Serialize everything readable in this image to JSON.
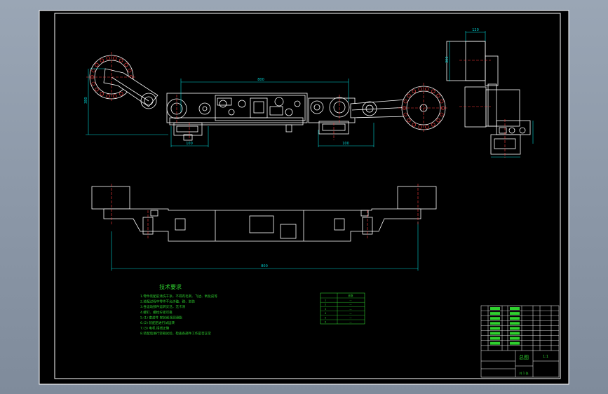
{
  "drawing": {
    "background": "#000000",
    "line_color": "#ffffff",
    "dim_color": "#00d6d6",
    "center_color": "#ff3b3b",
    "note_color": "#2fd02f",
    "title_color": "#2fd02f"
  },
  "dimensions": {
    "top_view_width": "800",
    "top_view_height": "380",
    "left_base": "100",
    "right_base": "100",
    "side_height": "300",
    "side_width": "120",
    "front_overall": "800"
  },
  "notes": {
    "heading": "技术要求",
    "lines": [
      "1.零件装配前清洗干净，不得有毛刺、飞边、氧化皮等",
      "2.装配过程中零件不允许磕、碰、划伤",
      "3.各运动部件运转灵活，无卡滞",
      "4.螺钉、螺栓拧紧可靠",
      "5.(1) 密封件 安装前涂润滑脂",
      "6.(2) 装配后进行试运转",
      "7.(3) 电机 接线正确",
      "8.装配后进行空载试验，检查各部件工作是否正常"
    ]
  },
  "param_table": {
    "header": [
      "",
      "参数"
    ],
    "rows": [
      [
        "1",
        "—"
      ],
      [
        "2",
        "—"
      ],
      [
        "3",
        "—"
      ],
      [
        "4",
        "—"
      ],
      [
        "5",
        "—"
      ],
      [
        "6",
        "—"
      ]
    ]
  },
  "title_block": {
    "drawing_name": "总图",
    "scale": "1:1",
    "sheet": "共 1 张"
  }
}
